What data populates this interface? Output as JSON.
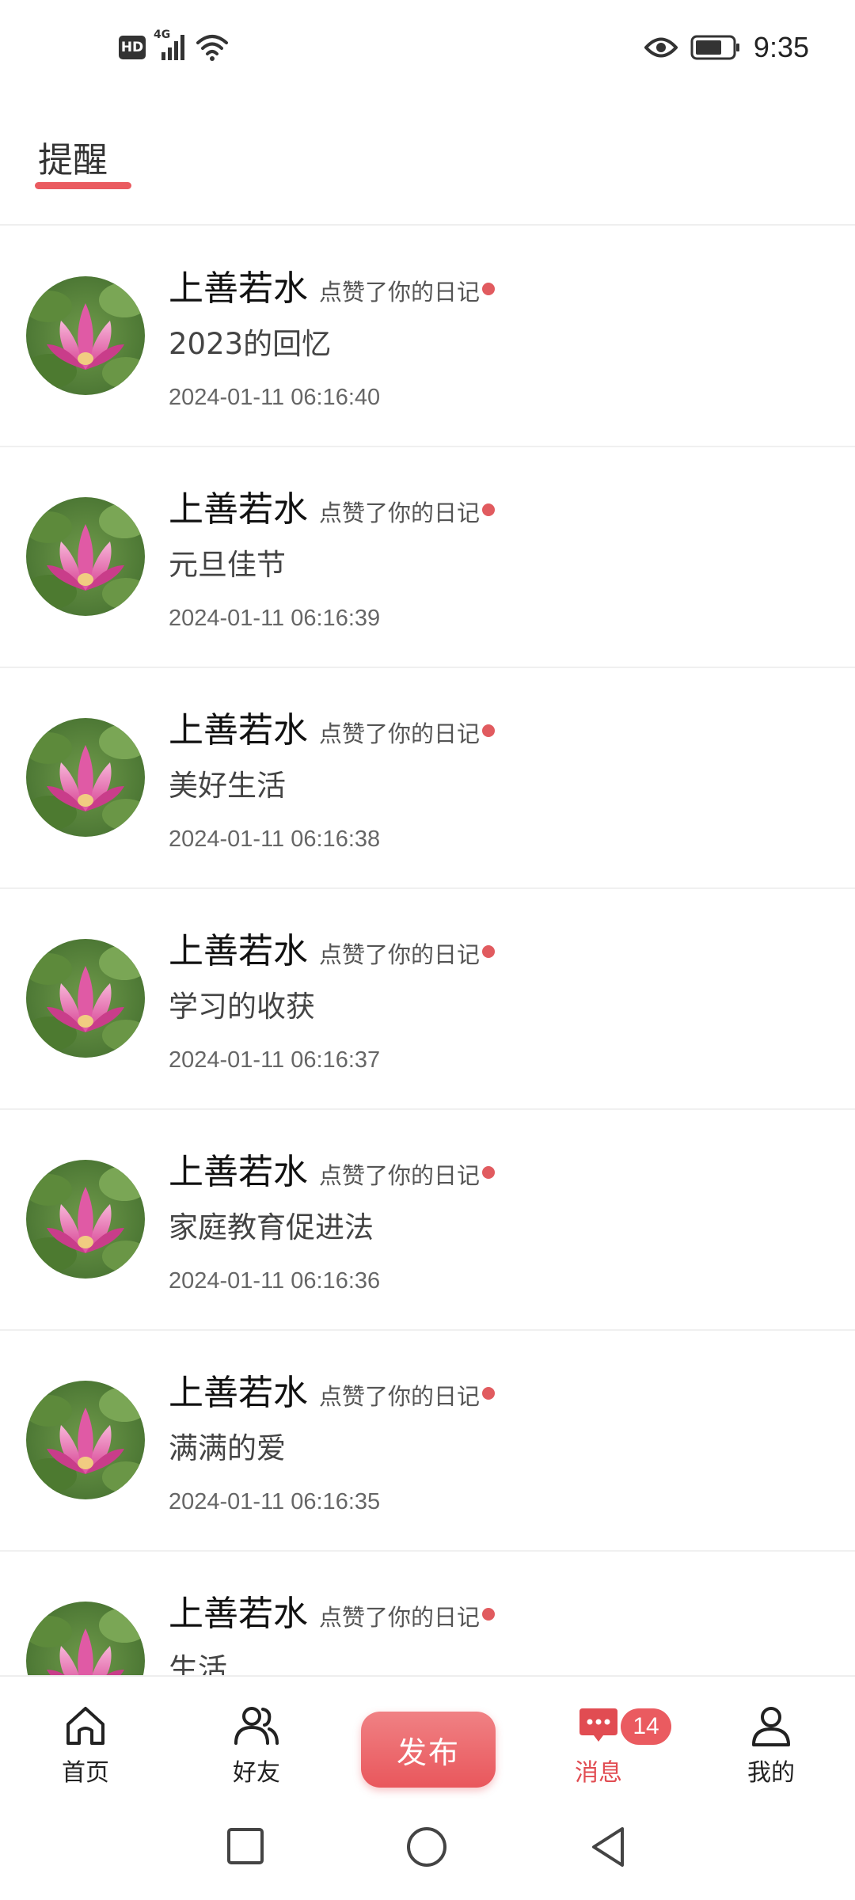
{
  "status_bar": {
    "hd": "HD",
    "network": "4G",
    "time": "9:35"
  },
  "header": {
    "active_tab": "提醒"
  },
  "notifications": [
    {
      "user": "上善若水",
      "action": "点赞了你的日记",
      "title": "2023的回忆",
      "time": "2024-01-11 06:16:40"
    },
    {
      "user": "上善若水",
      "action": "点赞了你的日记",
      "title": "元旦佳节",
      "time": "2024-01-11 06:16:39"
    },
    {
      "user": "上善若水",
      "action": "点赞了你的日记",
      "title": "美好生活",
      "time": "2024-01-11 06:16:38"
    },
    {
      "user": "上善若水",
      "action": "点赞了你的日记",
      "title": "学习的收获",
      "time": "2024-01-11 06:16:37"
    },
    {
      "user": "上善若水",
      "action": "点赞了你的日记",
      "title": "家庭教育促进法",
      "time": "2024-01-11 06:16:36"
    },
    {
      "user": "上善若水",
      "action": "点赞了你的日记",
      "title": "满满的爱",
      "time": "2024-01-11 06:16:35"
    },
    {
      "user": "上善若水",
      "action": "点赞了你的日记",
      "title": "生活",
      "time": ""
    }
  ],
  "bottom_nav": {
    "home": "首页",
    "friends": "好友",
    "publish": "发布",
    "messages": "消息",
    "messages_badge": "14",
    "mine": "我的"
  },
  "colors": {
    "accent": "#ea5b60",
    "unread_dot": "#e15b5f"
  },
  "icons": [
    "hd-icon",
    "signal-icon",
    "wifi-icon",
    "eye-icon",
    "battery-icon",
    "home-icon",
    "friends-icon",
    "chat-bubble-icon",
    "user-icon",
    "recent-apps-icon",
    "home-circle-icon",
    "back-icon"
  ]
}
